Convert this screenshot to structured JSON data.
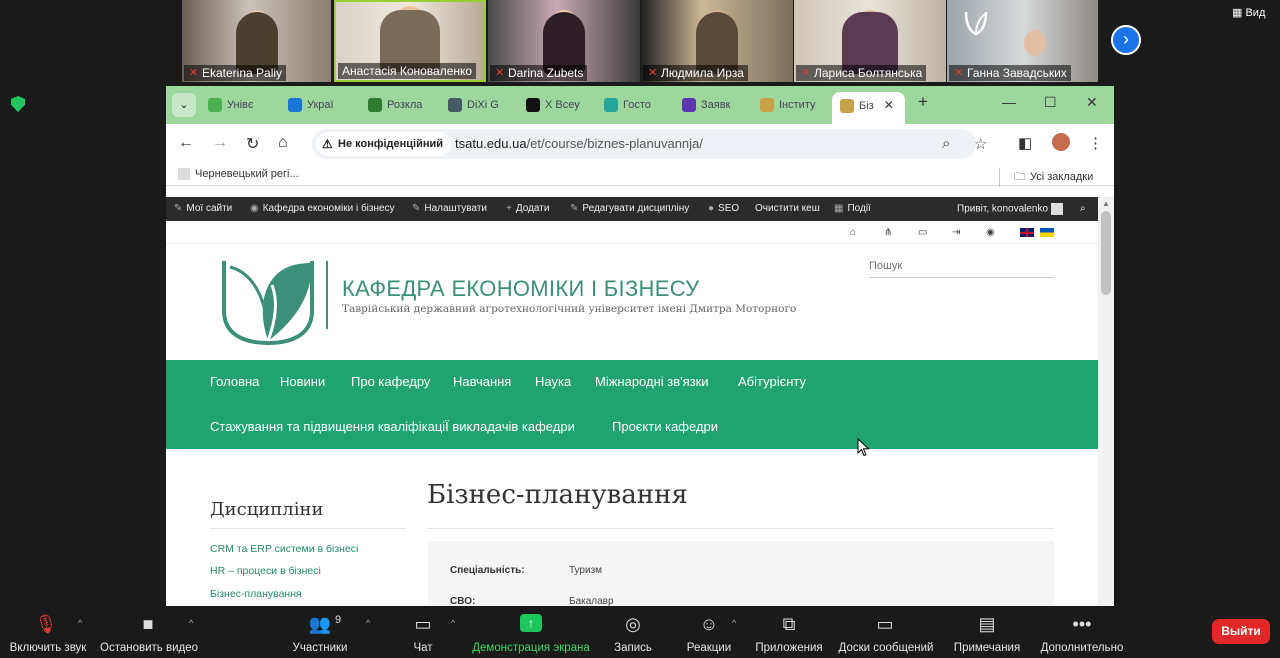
{
  "participants": [
    {
      "name": "Ekaterina Paliy",
      "muted": true
    },
    {
      "name": "Анастасія Коноваленко",
      "muted": false
    },
    {
      "name": "Darina Zubets",
      "muted": true
    },
    {
      "name": "Людмила Ирза",
      "muted": true
    },
    {
      "name": "Лариса Болтянська",
      "muted": true
    },
    {
      "name": "Ганна Завадських",
      "muted": true
    }
  ],
  "view_label": "Вид",
  "tabs": [
    {
      "label": "Унівє",
      "color": "#4caf50"
    },
    {
      "label": "Украї",
      "color": "#1976d2"
    },
    {
      "label": "Розкла",
      "color": "#2e7d32"
    },
    {
      "label": "DiXi G",
      "color": "#455a64"
    },
    {
      "label": "X Всеу",
      "color": "#111111"
    },
    {
      "label": "Госто",
      "color": "#26a69a"
    },
    {
      "label": "Заявк",
      "color": "#5e35b1"
    },
    {
      "label": "Інститу",
      "color": "#c8a24a"
    },
    {
      "label": "Біз",
      "color": "#c8a24a"
    }
  ],
  "omnibox": {
    "security_label": "Не конфіденційний",
    "domain": "tsatu.edu.ua",
    "path": "/et/course/biznes-planuvannja/"
  },
  "bookmarks": {
    "item": "Черневецький регі...",
    "all": "Усі закладки"
  },
  "adminbar": {
    "my_sites": "Мої сайти",
    "site": "Кафедра економіки і бізнесу",
    "customize": "Налаштувати",
    "add": "Додати",
    "edit": "Редагувати дисципліну",
    "seo": "SEO",
    "clear_cache": "Очистити кеш",
    "events": "Події",
    "greeting": "Привіт, konovalenko"
  },
  "site": {
    "title": "КАФЕДРА ЕКОНОМІКИ І БІЗНЕСУ",
    "subtitle": "Таврійський державний агротехнологічний університет імені Дмитра Моторного",
    "search_placeholder": "Пошук",
    "menu_row1": [
      "Головна",
      "Новини",
      "Про кафедру",
      "Навчання",
      "Наука",
      "Міжнародні зв'язки",
      "Абітурієнту"
    ],
    "menu_row2": [
      "Стажування та підвищення кваліфікаціЇ викладачів кафедри",
      "Проєкти кафедри"
    ],
    "sidebar_title": "Дисципліни",
    "sidebar_links": [
      "CRM та ERP системи в бізнесі",
      "HR – процеси в бізнесі",
      "Бізнес-планування"
    ],
    "page_title": "Бізнес-планування",
    "info": [
      {
        "key": "Спеціальність:",
        "value": "Туризм"
      },
      {
        "key": "СВО:",
        "value": "Бакалавр"
      }
    ],
    "brand_color": "#21a36f"
  },
  "zoom_controls": {
    "unmute": "Включить звук",
    "stop_video": "Остановить видео",
    "participants": "Участники",
    "participants_count": "9",
    "chat": "Чат",
    "share": "Демонстрация экрана",
    "record": "Запись",
    "reactions": "Реакции",
    "apps": "Приложения",
    "whiteboards": "Доски сообщений",
    "notes": "Примечания",
    "more": "Дополнительно",
    "leave": "Выйти"
  }
}
